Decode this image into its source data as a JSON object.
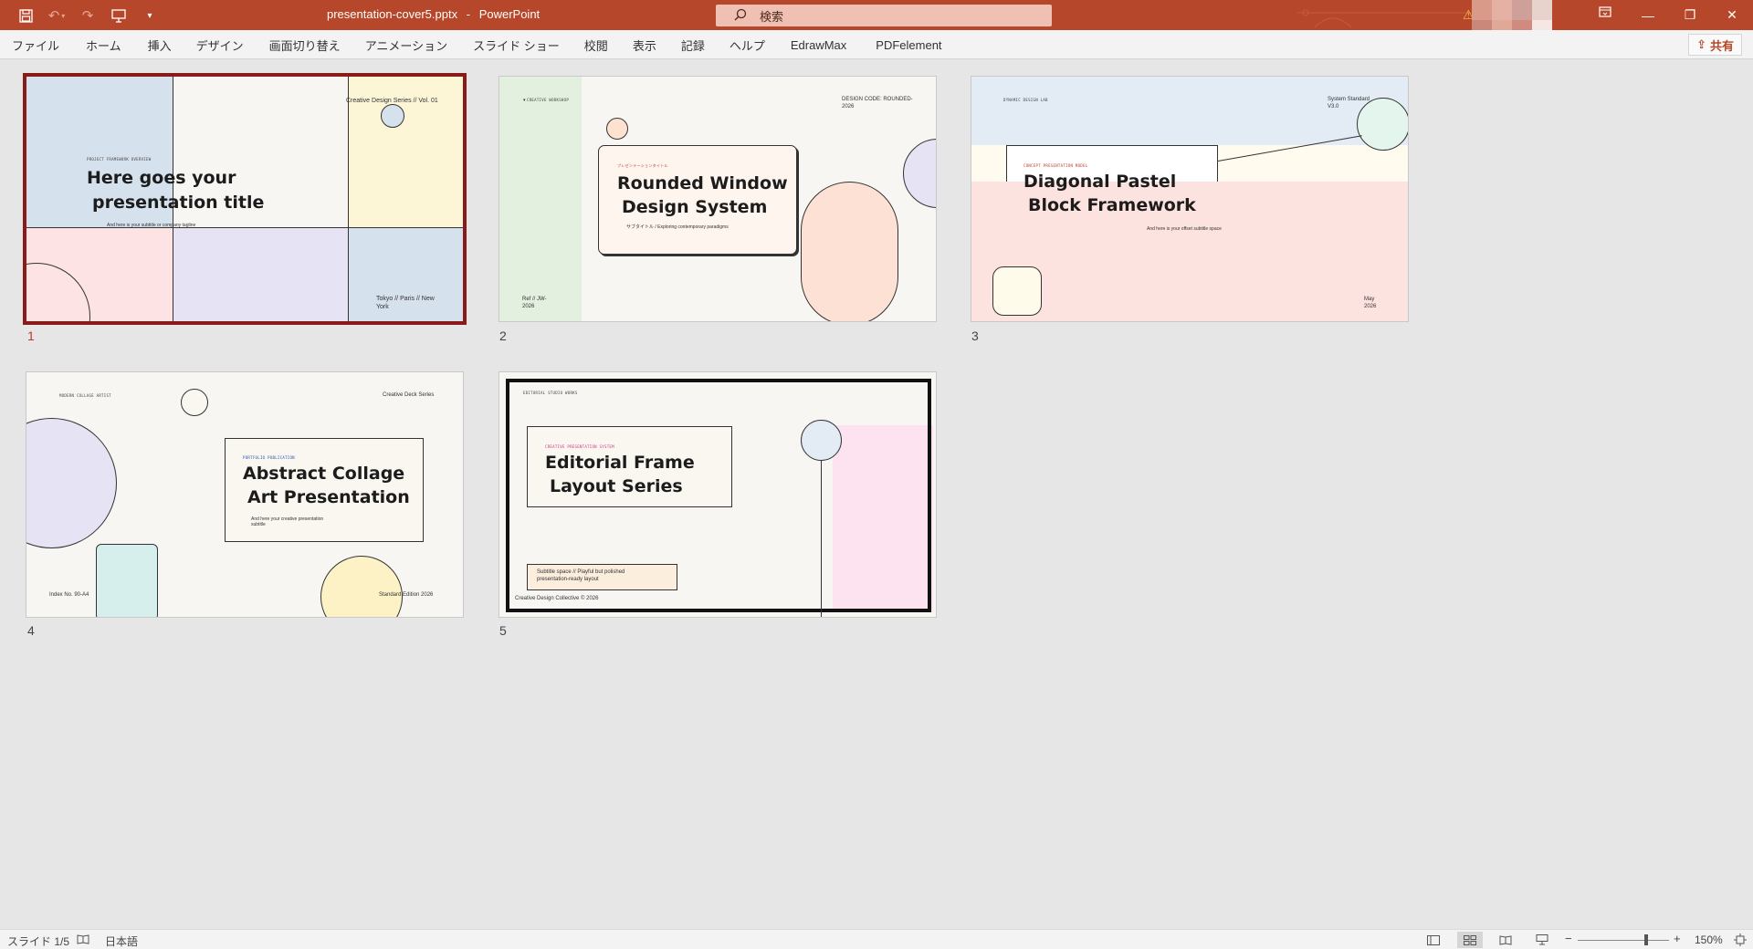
{
  "titlebar": {
    "filename": "presentation-cover5.pptx",
    "separator": "-",
    "app": "PowerPoint",
    "search_placeholder": "検索",
    "share_label": "共有",
    "colors": {
      "accent": "#b7472a"
    }
  },
  "menu": [
    "ファイル",
    "ホーム",
    "挿入",
    "デザイン",
    "画面切り替え",
    "アニメーション",
    "スライド ショー",
    "校閲",
    "表示",
    "記録",
    "ヘルプ",
    "EdrawMax",
    "PDFelement"
  ],
  "slides": [
    {
      "number": "1",
      "kicker": "PROJECT FRAMEWORK OVERVIEW",
      "series": "Creative Design Series // Vol. 01",
      "title_l1": "Here goes your",
      "title_l2": "presentation title",
      "subtitle": "And here is your subtitle or company tagline",
      "location": "Tokyo // Paris // New York"
    },
    {
      "number": "2",
      "kicker": "CREATIVE WORKSHOP",
      "code": "DESIGN CODE: ROUNDED-2026",
      "jp_label": "プレゼンテーションタイトル",
      "title_l1": "Rounded Window",
      "title_l2": "Design System",
      "subtitle": "サブタイトル / Exploring contemporary paradigms",
      "ref": "Ref // JW-2026"
    },
    {
      "number": "3",
      "kicker": "DYNAMIC DESIGN LAB",
      "standard": "System Standard V3.0",
      "label": "CONCEPT PRESENTATION MODEL",
      "title_l1": "Diagonal Pastel",
      "title_l2": "Block Framework",
      "subtitle": "And here is your offset subtitle space",
      "date": "May 2026"
    },
    {
      "number": "4",
      "kicker": "MODERN COLLAGE ARTIST",
      "series": "Creative Deck Series",
      "label": "PORTFOLIO PUBLICATION",
      "title_l1": "Abstract Collage",
      "title_l2": "Art Presentation",
      "subtitle": "And here your creative presentation subtitle",
      "index": "Index No. 90-A4",
      "edition": "Standard Edition 2026"
    },
    {
      "number": "5",
      "kicker": "EDITORIAL STUDIO WORKS",
      "label": "CREATIVE PRESENTATION SYSTEM",
      "title_l1": "Editorial Frame",
      "title_l2": "Layout Series",
      "subtitle": "Subtitle space // Playful but polished presentation-ready layout",
      "footer": "Creative Design Collective © 2026"
    }
  ],
  "status": {
    "slide_counter": "スライド 1/5",
    "language": "日本語",
    "zoom": "150%",
    "zoom_minus": "−",
    "zoom_plus": "+"
  }
}
